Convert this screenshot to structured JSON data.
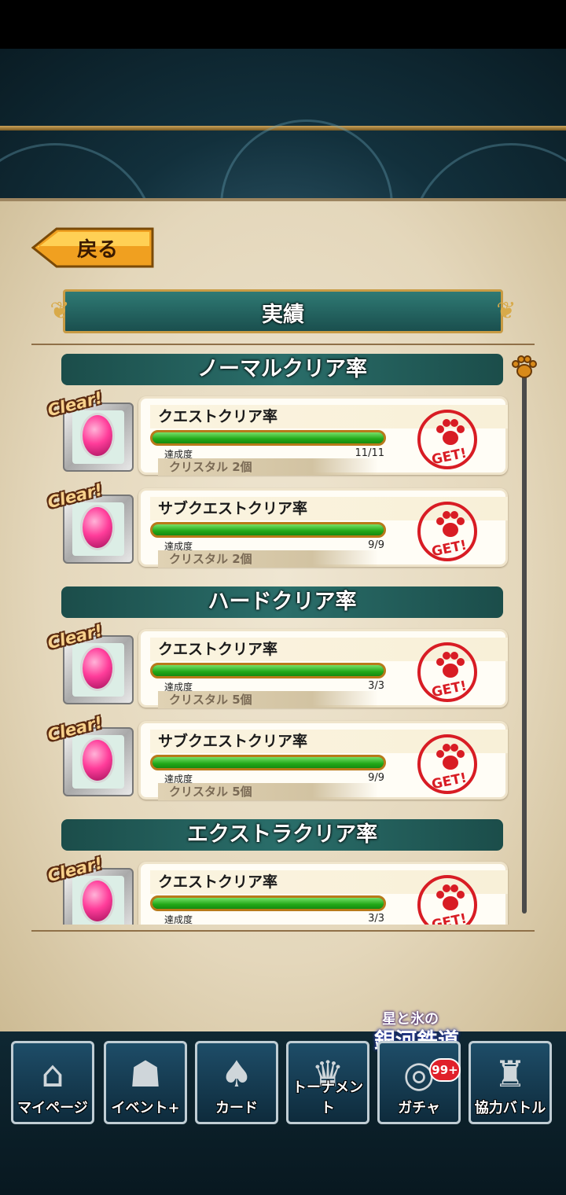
{
  "header": {
    "back_label": "戻る",
    "title": "実績"
  },
  "sections": [
    {
      "title": "ノーマルクリア率",
      "items": [
        {
          "clear": "Clear!",
          "name": "クエストクリア率",
          "progress_label": "達成度",
          "count": "11/11",
          "progress": 1.0,
          "reward": "クリスタル 2個",
          "get": "GET!"
        },
        {
          "clear": "Clear!",
          "name": "サブクエストクリア率",
          "progress_label": "達成度",
          "count": "9/9",
          "progress": 1.0,
          "reward": "クリスタル 2個",
          "get": "GET!"
        }
      ]
    },
    {
      "title": "ハードクリア率",
      "items": [
        {
          "clear": "Clear!",
          "name": "クエストクリア率",
          "progress_label": "達成度",
          "count": "3/3",
          "progress": 1.0,
          "reward": "クリスタル 5個",
          "get": "GET!"
        },
        {
          "clear": "Clear!",
          "name": "サブクエストクリア率",
          "progress_label": "達成度",
          "count": "9/9",
          "progress": 1.0,
          "reward": "クリスタル 5個",
          "get": "GET!"
        }
      ]
    },
    {
      "title": "エクストラクリア率",
      "items": [
        {
          "clear": "Clear!",
          "name": "クエストクリア率",
          "progress_label": "達成度",
          "count": "3/3",
          "progress": 1.0,
          "reward": "",
          "get": "GET!"
        }
      ]
    }
  ],
  "event_banner": {
    "line1": "星と氷の",
    "line2": "銀河鉄道"
  },
  "bottom_nav": [
    {
      "label": "マイページ",
      "icon": "house-icon"
    },
    {
      "label": "イベント+",
      "icon": "cat-icon"
    },
    {
      "label": "カード",
      "icon": "cards-icon"
    },
    {
      "label": "トーナメント",
      "icon": "trophy-icon"
    },
    {
      "label": "ガチャ",
      "icon": "gacha-icon",
      "badge": "99+"
    },
    {
      "label": "協力バトル",
      "icon": "castle-icon"
    }
  ],
  "colors": {
    "accent_teal": "#1b4d4a",
    "progress_green": "#22a818",
    "get_red": "#d81c24",
    "gold": "#c89b44"
  }
}
